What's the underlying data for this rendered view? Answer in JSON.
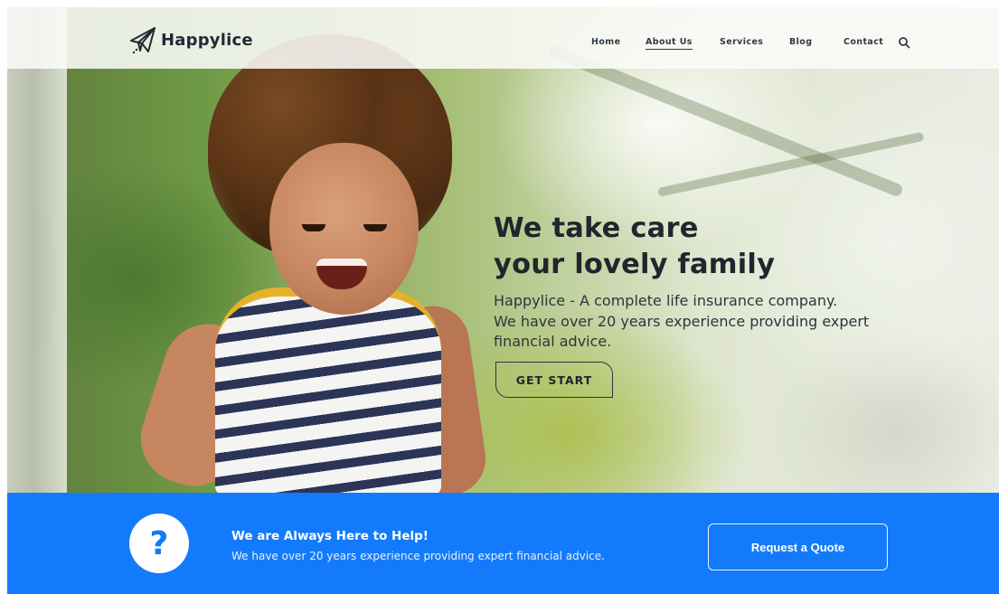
{
  "brand": {
    "name": "Happylice",
    "logo_icon": "paper-plane-icon"
  },
  "nav": {
    "items": [
      {
        "label": "Home",
        "active": false
      },
      {
        "label": "About Us",
        "active": true
      },
      {
        "label": "Services",
        "active": false
      },
      {
        "label": "Blog",
        "active": false
      },
      {
        "label": "Contact",
        "active": false
      }
    ],
    "search_icon": "search-icon"
  },
  "hero": {
    "title_lines": [
      "We take care",
      "your lovely family"
    ],
    "description_lines": [
      "Happylice - A complete life insurance company.",
      "We have over 20 years experience providing expert",
      "financial advice."
    ],
    "cta_label": "GET START"
  },
  "help_bar": {
    "icon": "question-mark-icon",
    "icon_glyph": "?",
    "title": "We are Always Here to Help!",
    "subtitle": "We have over 20 years experience providing expert financial advice.",
    "button_label": "Request a Quote",
    "background_color": "#137bfb"
  }
}
